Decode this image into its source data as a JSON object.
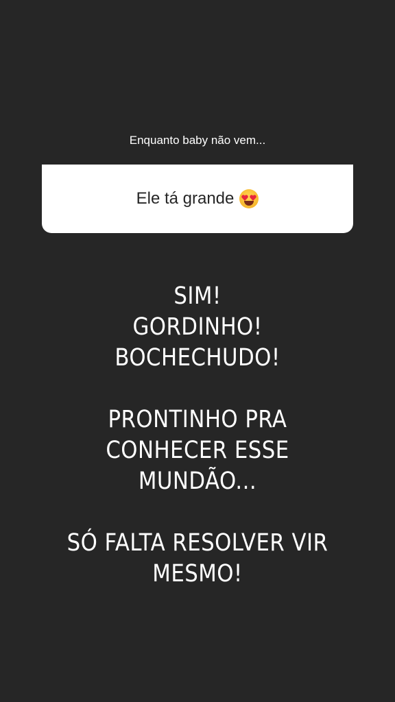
{
  "story": {
    "question_label": "Enquanto baby não vem...",
    "answer_text": "Ele tá grande",
    "answer_emoji": "heart-eyes-emoji",
    "colors": {
      "background": "#262626",
      "card": "#ffffff",
      "card_text": "#262626",
      "text": "#ffffff"
    },
    "main_text": {
      "line1": "SIM!",
      "line2": "GORDINHO!",
      "line3": "BOCHECHUDO!",
      "line4": "PRONTINHO PRA",
      "line5": "CONHECER ESSE",
      "line6": "MUNDÃO...",
      "line7": "SÓ FALTA RESOLVER VIR",
      "line8": "MESMO!"
    }
  }
}
